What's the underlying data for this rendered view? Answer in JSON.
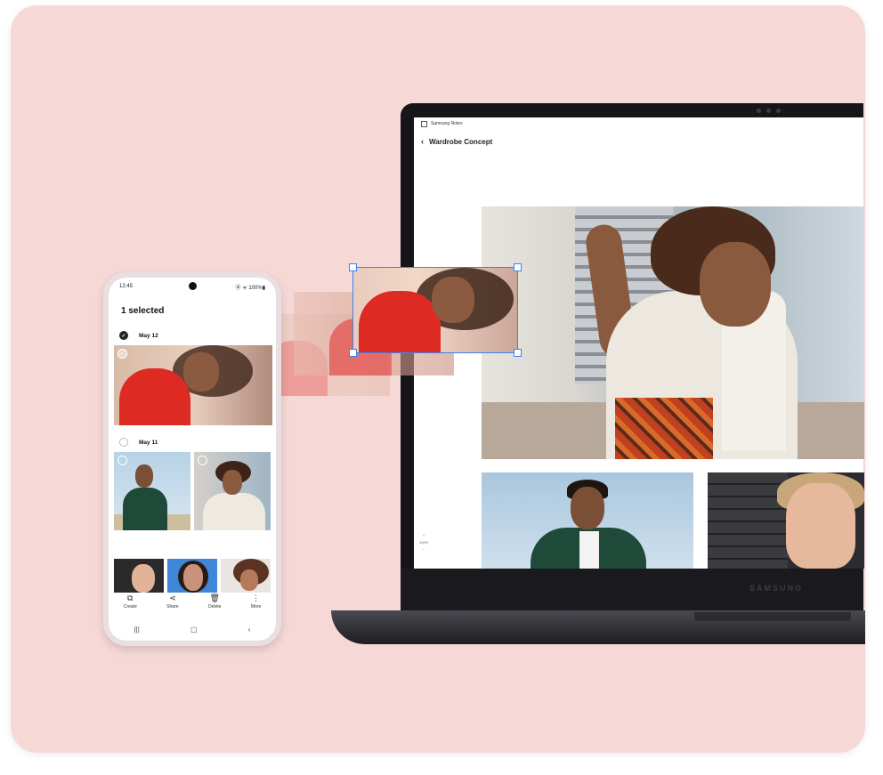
{
  "laptop": {
    "app_name": "Samsung Notes",
    "page_title": "Wardrobe Concept",
    "back_icon": "chevron-left-icon",
    "zoom_plus": "+",
    "zoom_value": "100%",
    "zoom_minus": "−",
    "brand": "SAMSUNG"
  },
  "phone": {
    "time": "12:45",
    "status_right": "⦿ ᯤ 100%▮",
    "selection_title": "1 selected",
    "groups": [
      {
        "date": "May 12",
        "checked": true
      },
      {
        "date": "May 11",
        "checked": false
      }
    ],
    "actions": [
      {
        "label": "Create",
        "icon": "create-icon",
        "glyph": "⧉"
      },
      {
        "label": "Share",
        "icon": "share-icon",
        "glyph": "⋖"
      },
      {
        "label": "Delete",
        "icon": "trash-icon",
        "glyph": "🗑"
      },
      {
        "label": "More",
        "icon": "more-vertical-icon",
        "glyph": "⋮"
      }
    ],
    "nav": {
      "recents": "|||",
      "home": "▢",
      "back": "‹"
    },
    "check_glyph": "✓"
  },
  "colors": {
    "background": "#f6d9d6",
    "selection_border": "#3b82f6",
    "accent_red": "#dd2b23"
  }
}
